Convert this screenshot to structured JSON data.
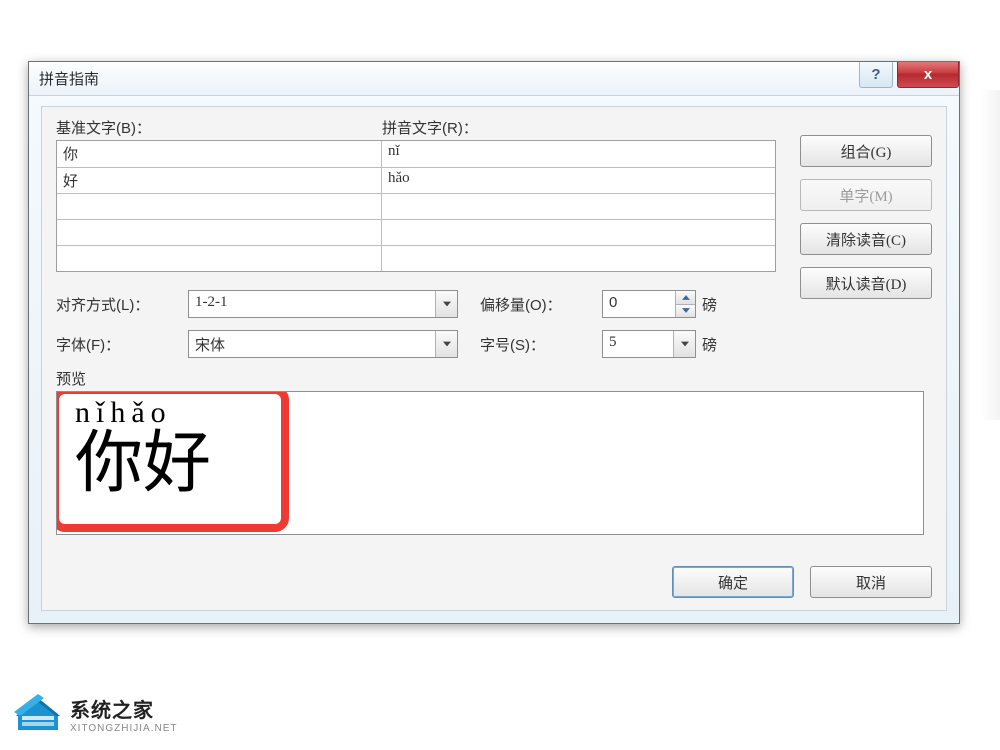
{
  "dialog": {
    "title": "拼音指南",
    "help": "?",
    "close": "x"
  },
  "labels": {
    "base": "基准文字(B)：",
    "ruby": "拼音文字(R)：",
    "align": "对齐方式(L)：",
    "offset": "偏移量(O)：",
    "font": "字体(F)：",
    "size": "字号(S)：",
    "unit": "磅",
    "preview": "预览"
  },
  "rows": [
    {
      "base": "你",
      "ruby": "nǐ"
    },
    {
      "base": "好",
      "ruby": "hǎo"
    },
    {
      "base": "",
      "ruby": ""
    },
    {
      "base": "",
      "ruby": ""
    },
    {
      "base": "",
      "ruby": ""
    }
  ],
  "buttons": {
    "combine": "组合(G)",
    "single": "单字(M)",
    "clear": "清除读音(C)",
    "default": "默认读音(D)",
    "ok": "确定",
    "cancel": "取消"
  },
  "values": {
    "align": "1-2-1",
    "offset": "0",
    "font": "宋体",
    "size": "5"
  },
  "preview": {
    "ruby": "nǐhǎo",
    "base": "你好"
  },
  "watermark": {
    "line1": "系统之家",
    "line2": "XITONGZHIJIA.NET"
  }
}
